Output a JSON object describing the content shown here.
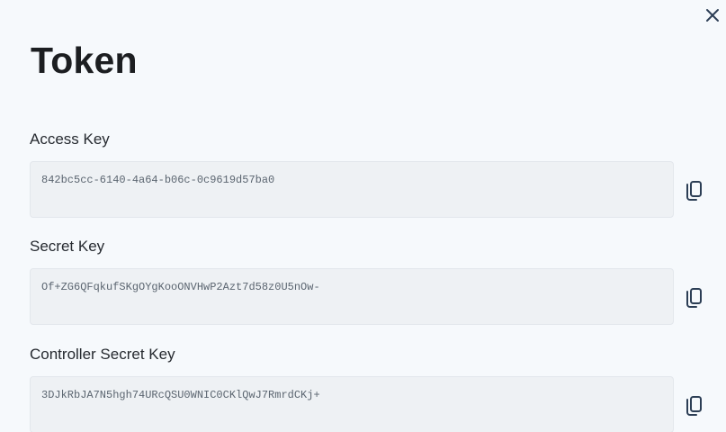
{
  "dialog": {
    "title": "Token",
    "close_icon": "close-icon"
  },
  "fields": {
    "access_key": {
      "label": "Access Key",
      "value": "842bc5cc-6140-4a64-b06c-0c9619d57ba0",
      "copy_icon": "copy-icon"
    },
    "secret_key": {
      "label": "Secret Key",
      "value": "Of+ZG6QFqkufSKgOYgKooONVHwP2Azt7d58z0U5nOw-",
      "copy_icon": "copy-icon"
    },
    "controller_secret_key": {
      "label": "Controller Secret Key",
      "value": "3DJkRbJA7N5hgh74URcQSU0WNIC0CKlQwJ7RmrdCKj+",
      "copy_icon": "copy-icon"
    }
  },
  "colors": {
    "background": "#f6f9fc",
    "field_background": "#eef1f4",
    "icon": "#2c3e55"
  }
}
